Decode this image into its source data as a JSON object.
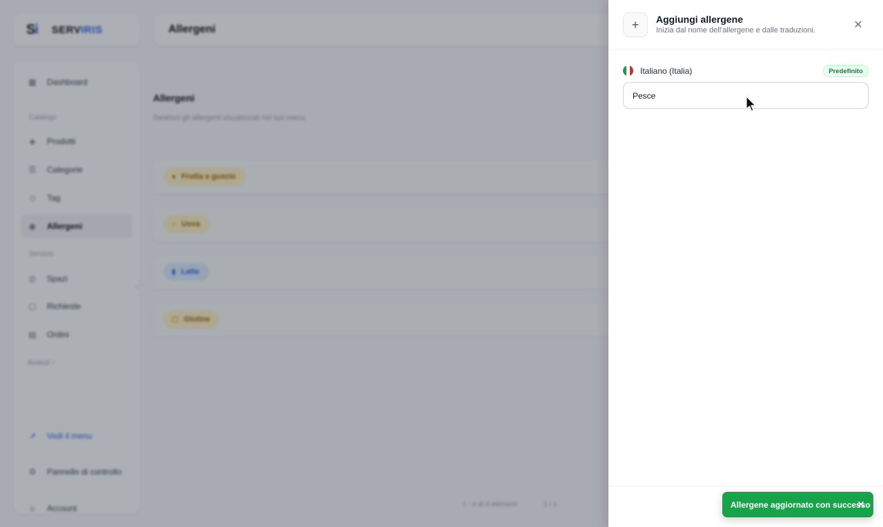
{
  "background": {
    "logo": {
      "mark": "S",
      "mark_accent": "i",
      "text": "SERV",
      "text_accent": "IRIS"
    },
    "header_title": "Allergeni",
    "nav": {
      "dashboard": "Dashboard",
      "section_catalog": "Catalogo",
      "products": "Prodotti",
      "categories": "Categorie",
      "tags": "Tag",
      "allergens": "Allergeni",
      "section_service": "Servizio",
      "spaces": "Spazi",
      "requests": "Richieste",
      "orders": "Ordini",
      "advanced": "Avanzi",
      "view_menu": "Vedi il menu",
      "control_panel": "Pannello di controllo",
      "account": "Account"
    },
    "main": {
      "title": "Allergeni",
      "subtitle": "Gestisci gli allergeni visualizzati nel tuo menu",
      "rows": [
        {
          "label": "Frutta a guscio",
          "color": "yellow"
        },
        {
          "label": "Uova",
          "color": "yellow"
        },
        {
          "label": "Latte",
          "color": "blue"
        },
        {
          "label": "Glutine",
          "color": "yellow"
        }
      ],
      "footer_left": "1 - 4 di 4 elementi",
      "footer_right": "1 / 1"
    }
  },
  "drawer": {
    "title": "Aggiungi allergene",
    "subtitle": "Inizia dal nome dell'allergene e dalle traduzioni.",
    "language_label": "Italiano (Italia)",
    "default_badge": "Predefinito",
    "name_value": "Pesce",
    "name_placeholder": ""
  },
  "toast": {
    "message": "Allergene aggiornato con successo",
    "color": "#16a34a"
  }
}
